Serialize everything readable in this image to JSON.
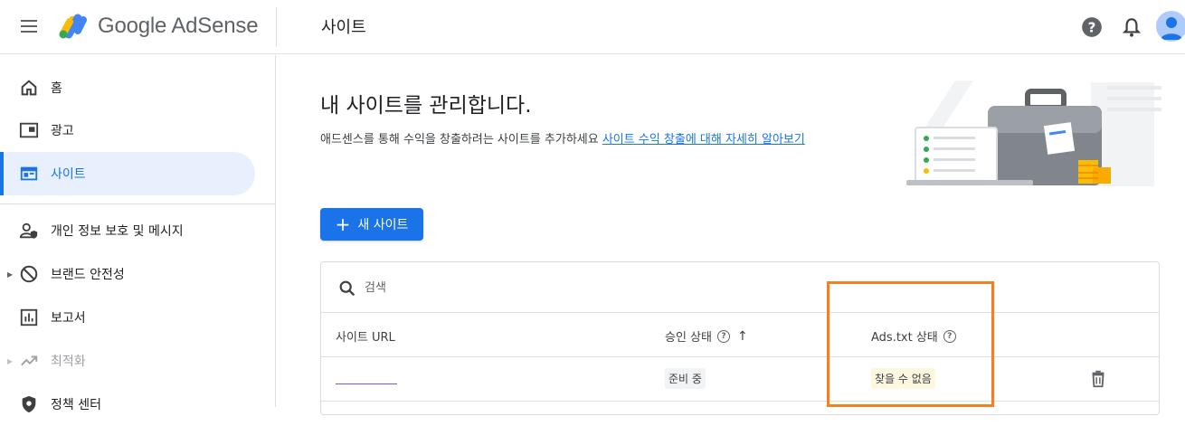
{
  "header": {
    "logo_text": "Google AdSense",
    "page_title": "사이트"
  },
  "sidebar": {
    "items": [
      {
        "label": "홈",
        "icon": "home-icon"
      },
      {
        "label": "광고",
        "icon": "ads-icon"
      },
      {
        "label": "사이트",
        "icon": "sites-icon",
        "active": true
      },
      {
        "label": "개인 정보 보호 및 메시지",
        "icon": "privacy-icon"
      },
      {
        "label": "브랜드 안전성",
        "icon": "block-icon"
      },
      {
        "label": "보고서",
        "icon": "reports-icon"
      },
      {
        "label": "최적화",
        "icon": "trending-icon",
        "disabled": true
      },
      {
        "label": "정책 센터",
        "icon": "policy-icon"
      }
    ]
  },
  "main": {
    "headline": "내 사이트를 관리합니다.",
    "subtext": "애드센스를 통해 수익을 창출하려는 사이트를 추가하세요 ",
    "subtext_link": "사이트 수익 창출에 대해 자세히 알아보기",
    "new_site_button": "새 사이트"
  },
  "table": {
    "search_placeholder": "검색",
    "columns": {
      "site_url": "사이트 URL",
      "approval_status": "승인 상태",
      "ads_txt_status": "Ads.txt 상태"
    },
    "rows": [
      {
        "approval": "준비 중",
        "ads_txt": "찾을 수 없음"
      }
    ]
  },
  "colors": {
    "accent": "#1a73e8",
    "highlight": "#f4801f"
  }
}
